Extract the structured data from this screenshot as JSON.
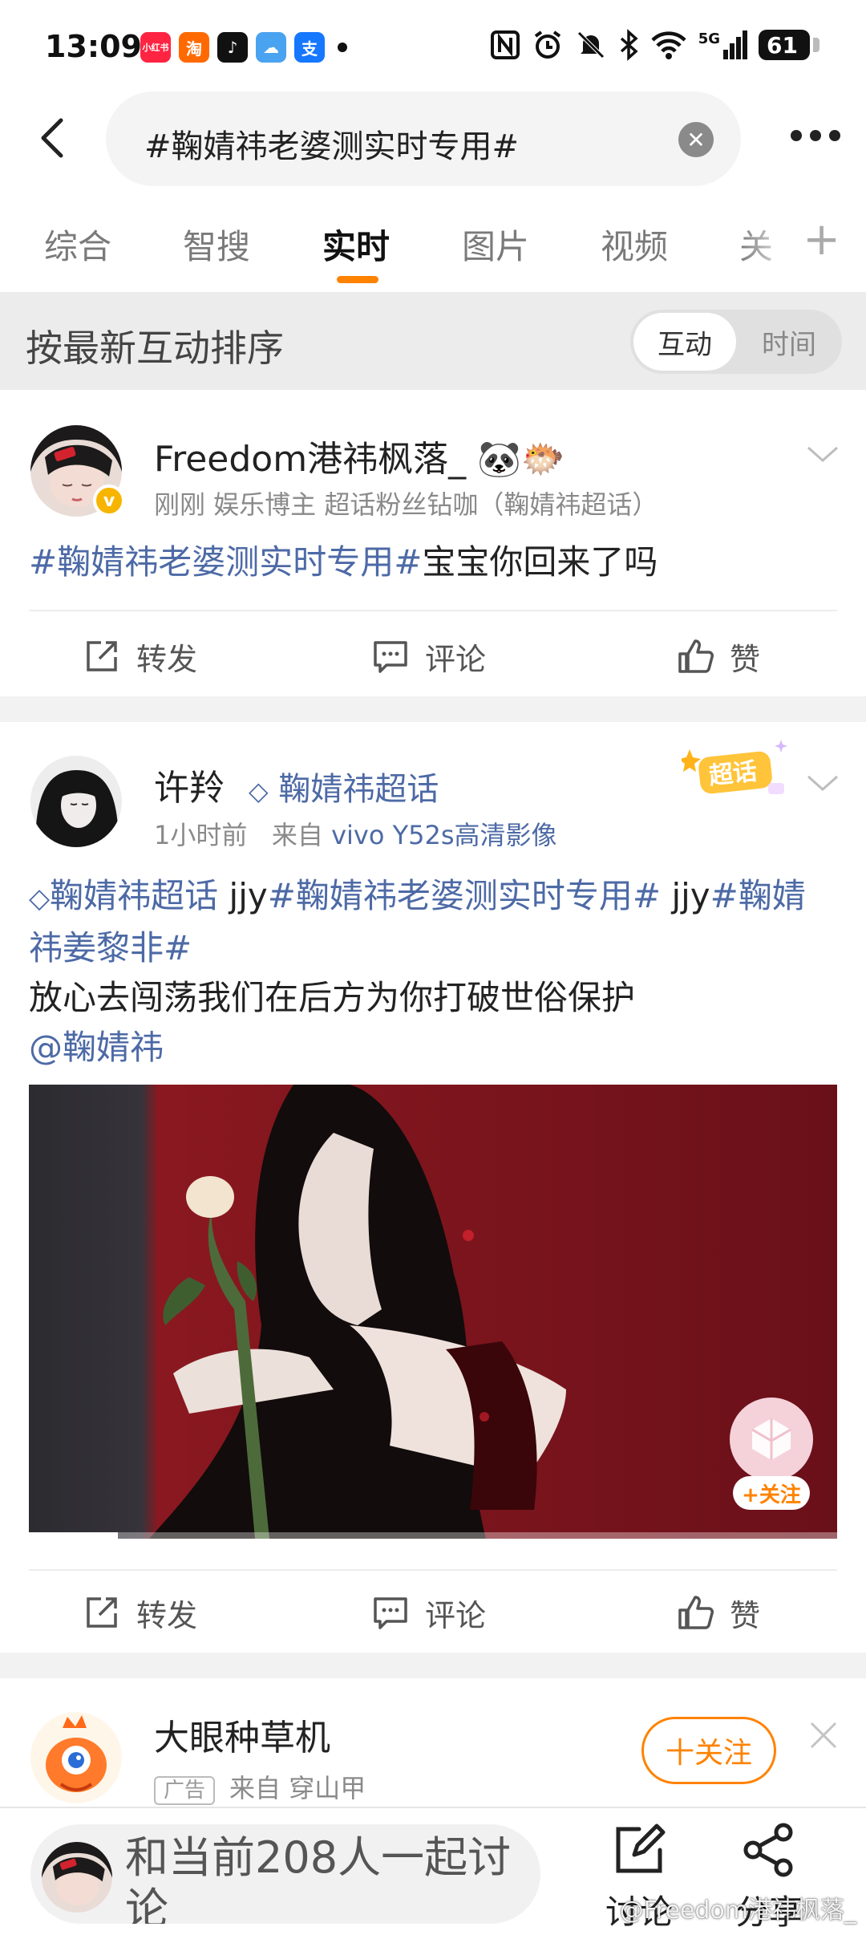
{
  "status_bar": {
    "time": "13:09",
    "network": "5G",
    "battery": "61",
    "app_icons": [
      {
        "name": "xiaohongshu-icon",
        "label": "小红书",
        "color": "#ff2442"
      },
      {
        "name": "taobao-icon",
        "label": "淘",
        "color": "#ff6a00"
      },
      {
        "name": "tiktok-icon",
        "label": "♪",
        "color": "#111111"
      },
      {
        "name": "weather-icon",
        "label": "☁",
        "color": "#4aa3f0"
      },
      {
        "name": "alipay-icon",
        "label": "支",
        "color": "#1677ff"
      }
    ]
  },
  "search": {
    "query": "#鞠婧祎老婆测实时专用#"
  },
  "tabs": [
    {
      "label": "综合"
    },
    {
      "label": "智搜"
    },
    {
      "label": "实时"
    },
    {
      "label": "图片"
    },
    {
      "label": "视频"
    },
    {
      "label": "关"
    }
  ],
  "sort": {
    "label": "按最新互动排序",
    "options": [
      "互动",
      "时间"
    ]
  },
  "posts": [
    {
      "author": "Freedom港祎枫落_",
      "emoji": "🐼🐡",
      "meta": "刚刚   娱乐博主 超话粉丝钻咖（鞠婧祎超话）",
      "text_tag": "#鞠婧祎老婆测实时专用#",
      "text_rest": "宝宝你回来了吗",
      "actions": [
        "转发",
        "评论",
        "赞"
      ]
    },
    {
      "author": "许羚",
      "super_topic": "鞠婧祎超话",
      "meta_time": "1小时前",
      "meta_source_prefix": "来自",
      "meta_source": "vivo Y52s高清影像",
      "badge_label": "超话",
      "line1_topic": "鞠婧祎超话",
      "line1_a": " jjy",
      "line1_tag1": "#鞠婧祎老婆测实时专用#",
      "line1_b": " jjy",
      "line1_tag2": "#鞠婧祎姜黎非#",
      "line2": "放心去闯荡我们在后方为你打破世俗保护",
      "mention": "@鞠婧祎",
      "video_progress": 0.11,
      "follow_label": "+关注",
      "actions": [
        "转发",
        "评论",
        "赞"
      ]
    }
  ],
  "ad": {
    "name": "大眼种草机",
    "tag": "广告",
    "source": "来自 穿山甲",
    "follow": "十关注"
  },
  "bottom": {
    "discuss_text": "和当前208人一起讨论",
    "buttons": [
      "讨论",
      "分享"
    ],
    "watermark": "@Freedom港祎枫落_"
  },
  "colors": {
    "accent": "#ff8200",
    "link": "#4d6aa6"
  }
}
